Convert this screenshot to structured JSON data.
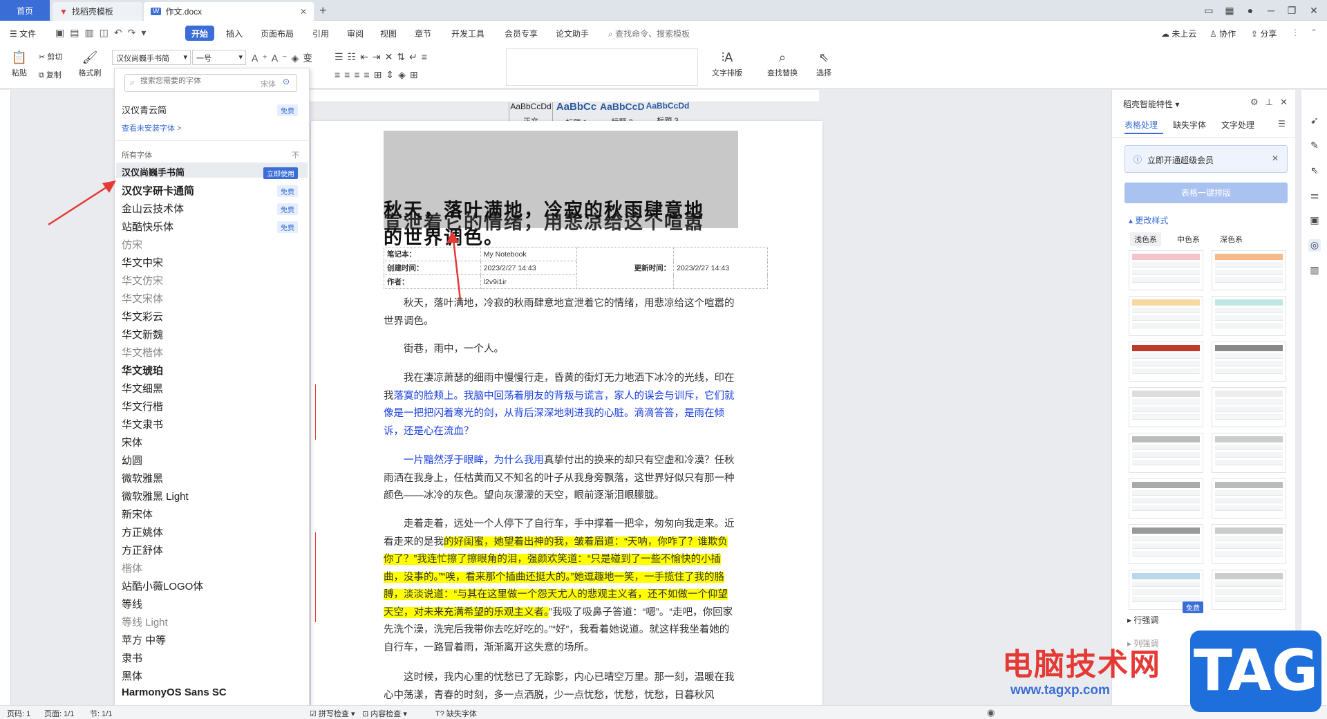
{
  "tabs": [
    {
      "label": "首页"
    },
    {
      "label": "找稻壳模板"
    },
    {
      "label": "作文.docx"
    }
  ],
  "menus": [
    "文件",
    "开始",
    "插入",
    "页面布局",
    "引用",
    "审阅",
    "视图",
    "章节",
    "开发工具",
    "会员专享",
    "论文助手"
  ],
  "search_cmd": "查找命令、搜索模板",
  "header_right": {
    "cloud": "未上云",
    "collab": "协作",
    "share": "分享"
  },
  "ribbon": {
    "paste": "粘贴",
    "cut": "剪切",
    "copy": "复制",
    "format_brush": "格式刷",
    "font_name": "汉仪尚巍手书简",
    "font_size": "一号",
    "styles": [
      {
        "preview": "AaBbCcDd",
        "label": "正文"
      },
      {
        "preview": "AaBbCc",
        "label": "标题 1"
      },
      {
        "preview": "AaBbCcD",
        "label": "标题 2"
      },
      {
        "preview": "AaBbCcDd",
        "label": "标题 3"
      }
    ],
    "text_layout": "文字排版",
    "find_replace": "查找替换",
    "select": "选择"
  },
  "font_panel": {
    "search_placeholder": "搜索您需要的字体",
    "search_hint": "宋体",
    "recent_font": "汉仪青云简",
    "recent_badge": "免费",
    "view_uninstalled": "查看未安装字体 >",
    "section_all": "所有字体",
    "section_icon": "不",
    "use_now": "立即使用",
    "fonts": [
      {
        "name": "汉仪尚巍手书简",
        "badge": "立即使用"
      },
      {
        "name": "汉仪字研卡通简",
        "badge": "免费"
      },
      {
        "name": "金山云技术体",
        "badge": "免费"
      },
      {
        "name": "站酷快乐体",
        "badge": "免费"
      },
      {
        "name": "仿宋",
        "badge": ""
      },
      {
        "name": "华文中宋",
        "badge": ""
      },
      {
        "name": "华文仿宋",
        "badge": ""
      },
      {
        "name": "华文宋体",
        "badge": ""
      },
      {
        "name": "华文彩云",
        "badge": ""
      },
      {
        "name": "华文新魏",
        "badge": ""
      },
      {
        "name": "华文楷体",
        "badge": ""
      },
      {
        "name": "华文琥珀",
        "badge": ""
      },
      {
        "name": "华文细黑",
        "badge": ""
      },
      {
        "name": "华文行楷",
        "badge": ""
      },
      {
        "name": "华文隶书",
        "badge": ""
      },
      {
        "name": "宋体",
        "badge": ""
      },
      {
        "name": "幼圆",
        "badge": ""
      },
      {
        "name": "微软雅黑",
        "badge": ""
      },
      {
        "name": "微软雅黑 Light",
        "badge": ""
      },
      {
        "name": "新宋体",
        "badge": ""
      },
      {
        "name": "方正姚体",
        "badge": ""
      },
      {
        "name": "方正舒体",
        "badge": ""
      },
      {
        "name": "楷体",
        "badge": ""
      },
      {
        "name": "站酷小薇LOGO体",
        "badge": ""
      },
      {
        "name": "等线",
        "badge": ""
      },
      {
        "name": "等线 Light",
        "badge": ""
      },
      {
        "name": "苹方 中等",
        "badge": ""
      },
      {
        "name": "隶书",
        "badge": ""
      },
      {
        "name": "黑体",
        "badge": ""
      },
      {
        "name": "HarmonyOS Sans SC",
        "badge": ""
      }
    ]
  },
  "document": {
    "title_line1": "秋天，落叶满地，冷寂的秋雨肆意地",
    "title_line2": "宣泄着它的情绪，用悲凉给这个喧嚣",
    "title_line3": "的世界调色。",
    "meta": {
      "notebook_label": "笔记本：",
      "notebook_value": "My Notebook",
      "created_label": "创建时间：",
      "created_value": "2023/2/27 14:43",
      "updated_label": "更新时间：",
      "updated_value": "2023/2/27 14:43",
      "author_label": "作者：",
      "author_value": "l2v9i1ir"
    },
    "p1": "秋天，落叶满地，冷寂的秋雨肆意地宣泄着它的情绪，用悲凉给这个喧嚣的世界调色。",
    "p2": "街巷，雨中，一个人。",
    "p3a": "我在凄凉萧瑟的细雨中慢慢行走，昏黄的街灯无力地洒下冰冷的光线，印在我",
    "p3b": "落寞的脸颊上。我脑中回荡着朋友的背叛与谎言，家人的误会与训斥，它们就像是一把把闪着寒光的剑，从背后深深地刺进我的心脏。滴滴答答，是雨在倾诉，还是心在流血？",
    "p4a": "一片黯然浮于眼眸，为什么我用",
    "p4b": "真挚付出的换来的却只有空虚和冷漠？任秋雨洒在我身上，任枯黄而又不知名的叶子从我身旁飘落，这世界好似只有那一种颜色——冰冷的灰色。望向灰濛濛的天空，眼前逐渐泪眼朦胧。",
    "p5a": "走着走着，远处一个人停下了自行车，手中撑着一把伞，匆匆向我走来。近看走来的是我",
    "p5b": "的好闺蜜，她望着出神的我，皱着眉道：“天呐，你咋了？谁欺负你了？”我连忙擦了擦眼角的泪，强颜欢笑道：“只是碰到了一些不愉快的小插曲，没事的。”“唉，看来那个插曲还挺大的。”她逗趣地一笑，一手揽住了我的胳膊，淡淡说道：“与其在这里做一个怨天尤人的悲观主义者，还不如做一个仰望天空，对未来充满希望的乐观主义者。",
    "p5c": "”我吸了吸鼻子答道：“嗯”。“走吧，你回家先洗个澡，洗完后我带你去吃好吃的。”“好”，我看着她说道。就这样我坐着她的自行车，一路冒着雨，渐渐离开这失意的场所。",
    "p6": "这时候，我内心里的忧愁已了无踪影，内心已晴空万里。那一刻，温暖在我心中荡漾，青春的时刻，多一点洒脱，少一点忧愁，忧愁，忧愁，日暮秋风"
  },
  "right_panel": {
    "title": "稻壳智能特性",
    "tabs": [
      "表格处理",
      "缺失字体",
      "文字处理"
    ],
    "notice": "立即开通超级会员",
    "one_click": "表格一键排版",
    "change_style": "更改样式",
    "color_tabs": [
      "浅色系",
      "中色系",
      "深色系"
    ],
    "free_badge": "免费",
    "row_adjust": "行强调",
    "col_adjust": "列强调"
  },
  "statusbar": {
    "page_num": "页码: 1",
    "pages": "页面: 1/1",
    "section": "节: 1/1",
    "spell": "拼写检查",
    "content_check": "内容检查",
    "missing_font": "缺失字体"
  },
  "watermark": {
    "text1": "电脑技术网",
    "text2": "www.tagxp.com",
    "logo": "TAG"
  },
  "colors": {
    "accent": "#3b6dd6",
    "arrow": "#e53935",
    "highlight": "#ffff00",
    "blue_text": "#1a3fe0"
  }
}
